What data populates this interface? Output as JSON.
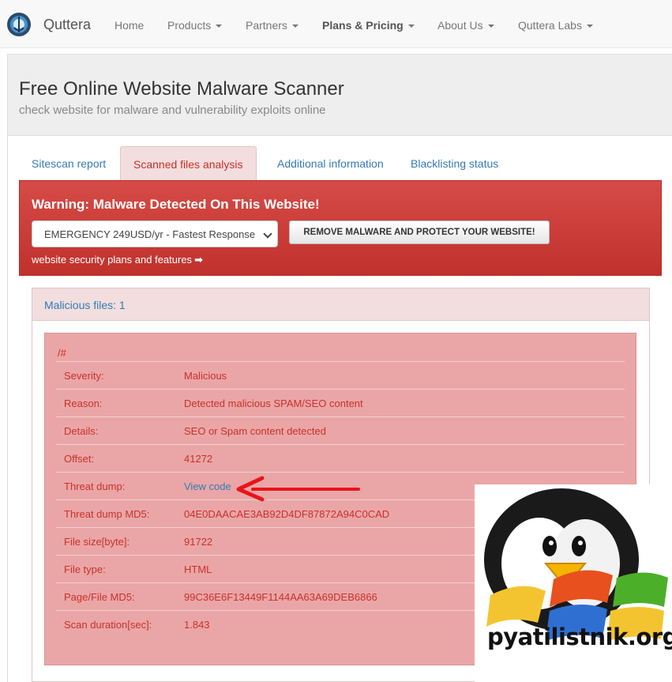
{
  "nav": {
    "brand": "Quttera",
    "items": [
      {
        "label": "Home",
        "caret": false
      },
      {
        "label": "Products",
        "caret": true
      },
      {
        "label": "Partners",
        "caret": true
      },
      {
        "label": "Plans & Pricing",
        "caret": true
      },
      {
        "label": "About Us",
        "caret": true
      },
      {
        "label": "Quttera Labs",
        "caret": true
      }
    ]
  },
  "header": {
    "title": "Free Online Website Malware Scanner",
    "subtitle": "check website for malware and vulnerability exploits online"
  },
  "tabs": [
    {
      "label": "Sitescan report",
      "active": false
    },
    {
      "label": "Scanned files analysis",
      "active": true
    },
    {
      "label": "Additional information",
      "active": false
    },
    {
      "label": "Blacklisting status",
      "active": false
    }
  ],
  "warning": {
    "title": "Warning: Malware Detected On This Website!",
    "select_value": "EMERGENCY 249USD/yr - Fastest Response",
    "remove_button": "REMOVE MALWARE AND PROTECT YOUR WEBSITE!",
    "plans_link": "website security plans and features",
    "arrow_glyph": "➡"
  },
  "malicious": {
    "count_label": "Malicious files: 1",
    "file_path": "/#",
    "rows": [
      {
        "label": "Severity:",
        "value": "Malicious"
      },
      {
        "label": "Reason:",
        "value": "Detected malicious SPAM/SEO content"
      },
      {
        "label": "Details:",
        "value": "SEO or Spam content detected"
      },
      {
        "label": "Offset:",
        "value": "41272"
      },
      {
        "label": "Threat dump:",
        "value": "View code"
      },
      {
        "label": "Threat dump MD5:",
        "value": "04E0DAACAE3AB92D4DF87872A94C0CAD"
      },
      {
        "label": "File size[byte]:",
        "value": "91722"
      },
      {
        "label": "File type:",
        "value": "HTML"
      },
      {
        "label": "Page/File MD5:",
        "value": "99C36E6F13449F1144AA63A69DEB6866"
      },
      {
        "label": "Scan duration[sec]:",
        "value": "1.843"
      }
    ]
  },
  "watermark": {
    "text": "pyatilistnik.org"
  },
  "colors": {
    "danger": "#c9302c",
    "link": "#337ab7",
    "banner": "#d0423e",
    "detail_bg": "#eaa6a6"
  }
}
